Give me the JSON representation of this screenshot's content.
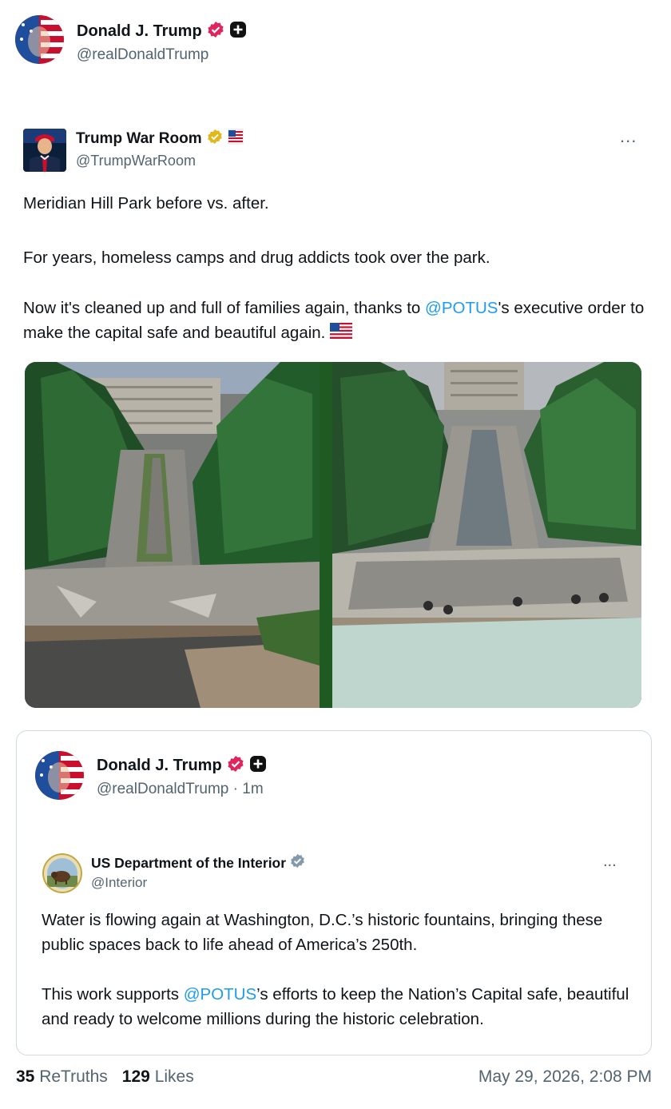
{
  "post": {
    "author": {
      "name": "Donald J. Trump",
      "handle": "@realDonaldTrump"
    },
    "quoted": {
      "author": {
        "name": "Trump War Room",
        "handle": "@TrumpWarRoom"
      },
      "more_label": "...",
      "paragraph1": "Meridian Hill Park before vs. after.",
      "paragraph2": "For years, homeless camps and drug addicts took over the park.",
      "paragraph3_pre": "Now it's cleaned up and full of families again, thanks to ",
      "paragraph3_mention": "@POTUS",
      "paragraph3_post": "'s executive order to make the capital safe and beautiful again."
    },
    "quote_card": {
      "author": {
        "name": "Donald J. Trump",
        "handle": "@realDonaldTrump",
        "time": " · 1m"
      },
      "inner": {
        "author": {
          "name": "US Department of the Interior",
          "handle": "@Interior"
        },
        "more_label": "...",
        "paragraph1": "Water is flowing again at Washington, D.C.’s historic fountains, bringing these public spaces back to life ahead of America’s 250th.",
        "paragraph2_pre": "This work supports ",
        "paragraph2_mention": "@POTUS",
        "paragraph2_post": "’s efforts to keep the Nation’s Capital safe, beautiful and ready to welcome millions during the historic celebration."
      }
    },
    "stats": {
      "retruths_count": "35",
      "retruths_label": "ReTruths",
      "likes_count": "129",
      "likes_label": "Likes",
      "timestamp": "May 29, 2026, 2:08 PM"
    }
  },
  "colors": {
    "verified_pink": "#e0245e",
    "gold_badge": "#e2b719",
    "gray_badge": "#829aab",
    "link_blue": "#1d9bf0",
    "text_gray": "#536471"
  }
}
